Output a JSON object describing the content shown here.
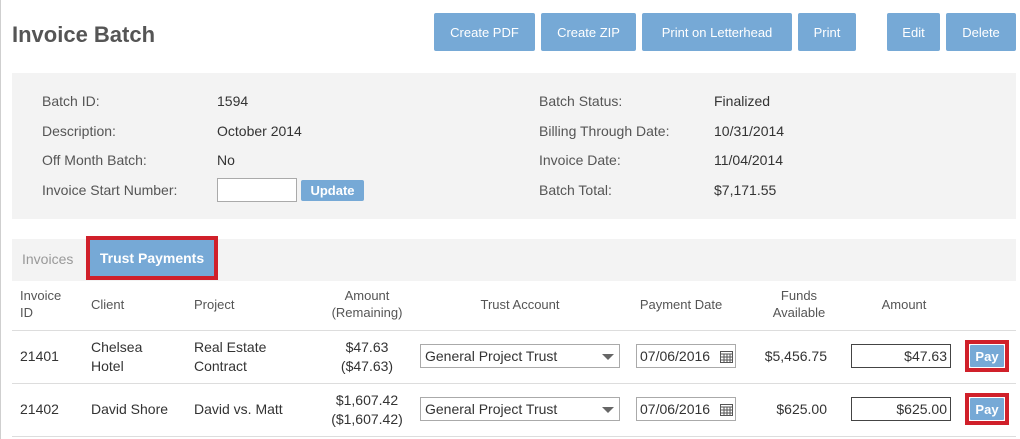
{
  "page": {
    "title": "Invoice Batch"
  },
  "toolbar": {
    "create_pdf": "Create PDF",
    "create_zip": "Create ZIP",
    "print_letterhead": "Print on Letterhead",
    "print": "Print",
    "edit": "Edit",
    "delete": "Delete"
  },
  "batch": {
    "id_label": "Batch ID:",
    "id_value": "1594",
    "description_label": "Description:",
    "description_value": "October 2014",
    "off_month_label": "Off Month Batch:",
    "off_month_value": "No",
    "start_number_label": "Invoice Start Number:",
    "start_number_value": "",
    "update_label": "Update",
    "status_label": "Batch Status:",
    "status_value": "Finalized",
    "billing_through_label": "Billing Through Date:",
    "billing_through_value": "10/31/2014",
    "invoice_date_label": "Invoice Date:",
    "invoice_date_value": "11/04/2014",
    "total_label": "Batch Total:",
    "total_value": "$7,171.55"
  },
  "tabs": {
    "invoices": "Invoices",
    "trust_payments": "Trust Payments"
  },
  "table": {
    "headers": {
      "invoice_id_1": "Invoice",
      "invoice_id_2": "ID",
      "client": "Client",
      "project": "Project",
      "amount_1": "Amount",
      "amount_2": "(Remaining)",
      "trust_account": "Trust Account",
      "payment_date": "Payment Date",
      "funds_1": "Funds",
      "funds_2": "Available",
      "amount_col": "Amount"
    },
    "rows": [
      {
        "invoice_id": "21401",
        "client_1": "Chelsea",
        "client_2": "Hotel",
        "project_1": "Real Estate",
        "project_2": "Contract",
        "amount": "$47.63",
        "remaining": "($47.63)",
        "trust_account": "General Project Trust",
        "payment_date": "07/06/2016",
        "funds_available": "$5,456.75",
        "pay_amount": "$47.63",
        "pay_label": "Pay"
      },
      {
        "invoice_id": "21402",
        "client_1": "David Shore",
        "project_1": "David vs. Matt",
        "amount": "$1,607.42",
        "remaining": "($1,607.42)",
        "trust_account": "General Project Trust",
        "payment_date": "07/06/2016",
        "funds_available": "$625.00",
        "pay_amount": "$625.00",
        "pay_label": "Pay"
      }
    ]
  },
  "colors": {
    "accent": "#76a9d6",
    "highlight": "#d0202a",
    "panel": "#f3f3f3"
  },
  "icons": {
    "calendar": "calendar-icon",
    "dropdown": "chevron-down-icon"
  }
}
